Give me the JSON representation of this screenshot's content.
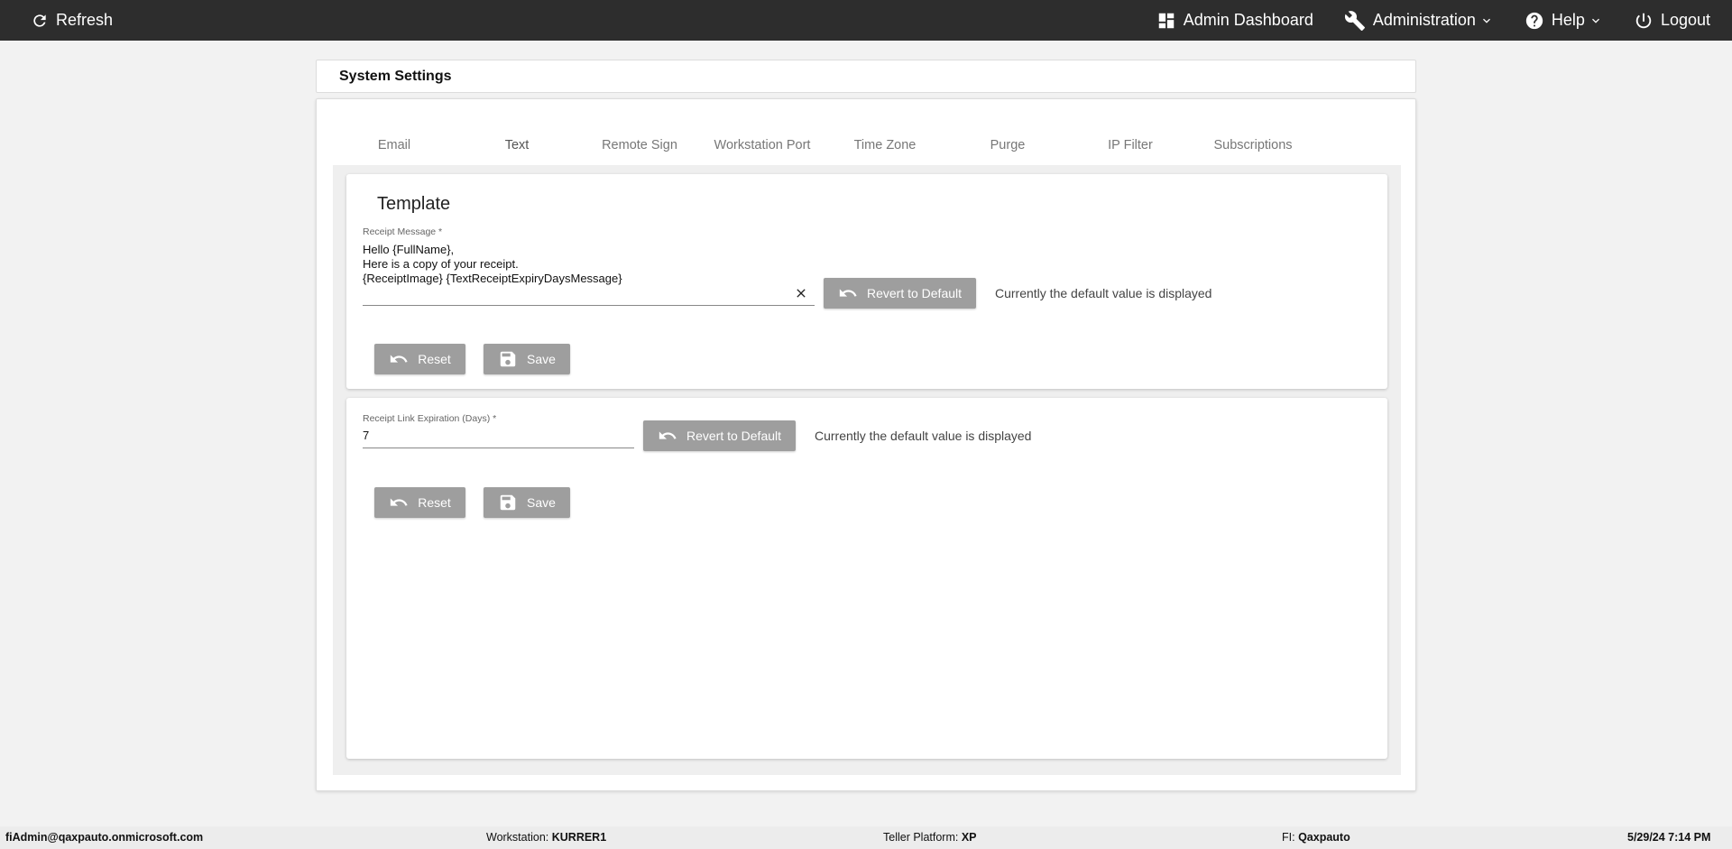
{
  "topbar": {
    "refresh_label": "Refresh",
    "admin_dashboard_label": "Admin Dashboard",
    "administration_label": "Administration",
    "help_label": "Help",
    "logout_label": "Logout"
  },
  "page": {
    "title": "System Settings"
  },
  "tabs": [
    {
      "label": "Email",
      "active": false
    },
    {
      "label": "Text",
      "active": true
    },
    {
      "label": "Remote Sign",
      "active": false
    },
    {
      "label": "Workstation Port",
      "active": false
    },
    {
      "label": "Time Zone",
      "active": false
    },
    {
      "label": "Purge",
      "active": false
    },
    {
      "label": "IP Filter",
      "active": false
    },
    {
      "label": "Subscriptions",
      "active": false
    }
  ],
  "template_panel": {
    "title": "Template",
    "receipt_message": {
      "label": "Receipt Message *",
      "value": "Hello {FullName},\nHere is a copy of your receipt.\n{ReceiptImage} {TextReceiptExpiryDaysMessage}"
    },
    "revert_label": "Revert to Default",
    "status_text": "Currently the default value is displayed",
    "reset_label": "Reset",
    "save_label": "Save"
  },
  "expiration_panel": {
    "field": {
      "label": "Receipt Link Expiration (Days) *",
      "value": "7"
    },
    "revert_label": "Revert to Default",
    "status_text": "Currently the default value is displayed",
    "reset_label": "Reset",
    "save_label": "Save"
  },
  "footer": {
    "user": "fiAdmin@qaxpauto.onmicrosoft.com",
    "workstation_label": "Workstation:",
    "workstation_value": "KURRER1",
    "platform_label": "Teller Platform:",
    "platform_value": "XP",
    "fi_label": "FI:",
    "fi_value": "Qaxpauto",
    "datetime": "5/29/24 7:14 PM"
  },
  "colors": {
    "topbar_bg": "#2d2d2d",
    "tab_indicator": "#3f51b5",
    "button_bg": "#9e9e9e"
  }
}
